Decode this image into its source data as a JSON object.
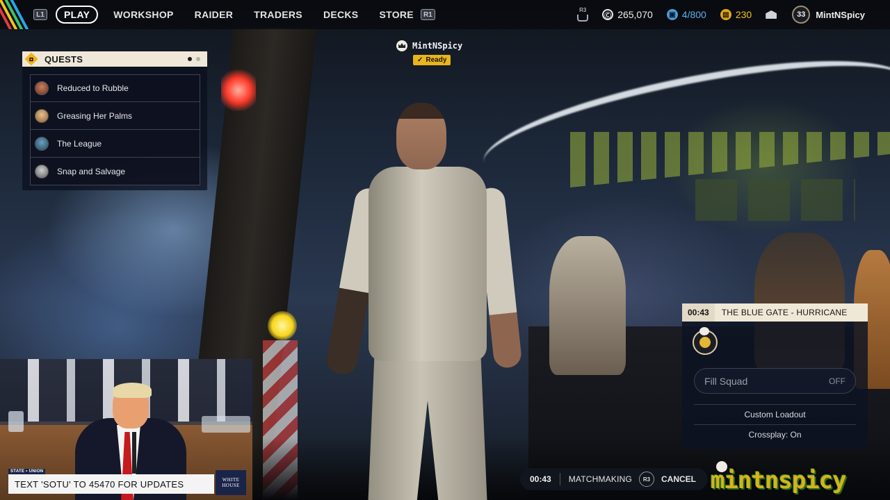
{
  "topbar": {
    "hints": {
      "left": "L1",
      "right": "R1",
      "r3": "R3"
    },
    "nav": [
      {
        "label": "PLAY",
        "active": true
      },
      {
        "label": "WORKSHOP",
        "active": false
      },
      {
        "label": "RAIDER",
        "active": false
      },
      {
        "label": "TRADERS",
        "active": false
      },
      {
        "label": "DECKS",
        "active": false
      },
      {
        "label": "STORE",
        "active": false
      }
    ],
    "currency": {
      "coins": "265,070",
      "storage": "4/800",
      "tokens": "230"
    },
    "icons": {
      "coins": "coin-icon",
      "storage": "backpack-icon",
      "tokens": "raider-token-icon",
      "mail": "inbox-icon"
    },
    "level": "33",
    "username": "MintNSpicy"
  },
  "quests": {
    "title": "QUESTS",
    "page_dots": [
      true,
      false
    ],
    "items": [
      {
        "name": "Reduced to Rubble",
        "avatar_color": "#8a4a34"
      },
      {
        "name": "Greasing Her Palms",
        "avatar_color": "#c9a06a"
      },
      {
        "name": "The League",
        "avatar_color": "#3a6a8a"
      },
      {
        "name": "Snap and Salvage",
        "avatar_color": "#9a9a9a"
      }
    ]
  },
  "player_tag": {
    "name": "MintNSpicy",
    "status": "Ready"
  },
  "matchmaking_panel": {
    "timer": "00:43",
    "map": "THE BLUE GATE - HURRICANE",
    "fill_squad_label": "Fill Squad",
    "fill_squad_value": "OFF",
    "loadout": "Custom Loadout",
    "crossplay": "Crossplay: On"
  },
  "matchmaking_bar": {
    "timer": "00:43",
    "status": "MATCHMAKING",
    "cancel_hint": "R3",
    "cancel_label": "CANCEL"
  },
  "overlay": {
    "news_ticker": "TEXT 'SOTU' TO 45470 FOR UPDATES",
    "state_tag": "STATE • UNION",
    "network_logo_line1": "WHITE",
    "network_logo_line2": "HOUSE"
  },
  "streamer_logo": "mintnspicy",
  "colors": {
    "accent_gold": "#e7b51c",
    "panel_header": "#efe8d8",
    "panel_bg": "#0c1222",
    "tie_red": "#c41a20"
  }
}
